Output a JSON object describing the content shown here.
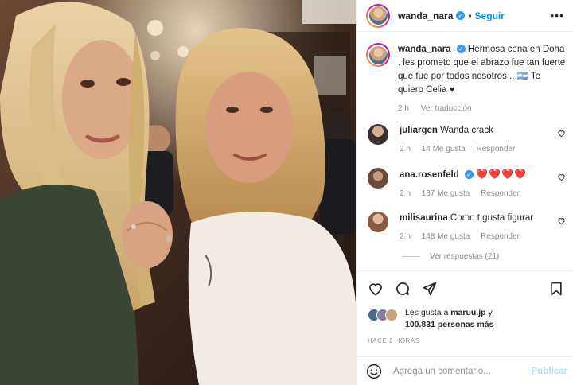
{
  "post": {
    "username": "wanda_nara",
    "follow_label": "Seguir",
    "separator": "•",
    "more_label": "•••"
  },
  "caption": {
    "username": "wanda_nara",
    "text": "Hermosa cena en Doha . les prometo que el abrazo fue tan fuerte que fue por todos nosotros .. 🇦🇷 Te quiero Celia ♥",
    "time": "2 h",
    "translate_label": "Ver traducción"
  },
  "comments": [
    {
      "username": "juliargen",
      "text": "Wanda crack",
      "time": "2 h",
      "likes": "14 Me gusta",
      "reply": "Responder",
      "verified": false
    },
    {
      "username": "ana.rosenfeld",
      "text": "❤️❤️❤️❤️",
      "time": "2 h",
      "likes": "137 Me gusta",
      "reply": "Responder",
      "verified": true
    },
    {
      "username": "milisaurina",
      "text": "Como t gusta figurar",
      "time": "2 h",
      "likes": "148 Me gusta",
      "reply": "Responder",
      "verified": false
    }
  ],
  "view_replies_label": "Ver respuestas (21)",
  "likes": {
    "prefix": "Les gusta a",
    "user": "maruu.jp",
    "connector": "y",
    "count": "100.831 personas más"
  },
  "time_ago": "HACE 2 HORAS",
  "comment_input": {
    "placeholder": "Agrega un comentario...",
    "post_label": "Publicar"
  },
  "colors": {
    "accent": "#0095f6",
    "heart": "#ed4956",
    "muted": "#8e8e8e"
  }
}
